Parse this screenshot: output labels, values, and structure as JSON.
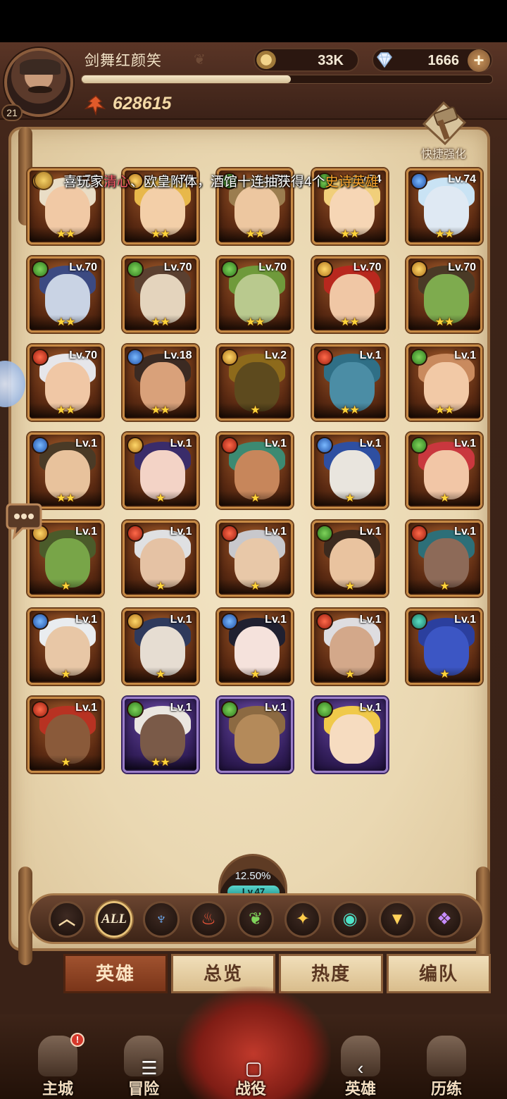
{
  "player": {
    "name": "剑舞红颜笑",
    "level": "21",
    "power": "628615",
    "xp_fraction": 0.51
  },
  "resources": {
    "gold": "33K",
    "gems": "1666"
  },
  "quick_upgrade": {
    "label": "快捷强化"
  },
  "ticker": {
    "prefix": "喜玩家",
    "player": "清心",
    "mid": "、欧皇附体，酒馆十连抽获得4个",
    "highlight": "史诗英雄"
  },
  "colors": {
    "faction_green": "#4aa83a",
    "faction_red": "#d8402a",
    "faction_blue": "#3a7cd8",
    "faction_gold": "#e0a838",
    "faction_teal": "#2fb59b",
    "faction_purple": "#8c4ee0",
    "tab_active": "#8b3e1f"
  },
  "heroes": [
    {
      "lv": "Lv.74",
      "stars": "★★",
      "faction": "gold",
      "hair": "#e9ddc6",
      "face": "#f1c9a5",
      "frame": "bronze"
    },
    {
      "lv": "Lv.74",
      "stars": "★★",
      "faction": "gold",
      "hair": "#e8b84a",
      "face": "#f3cfa8",
      "frame": "bronze"
    },
    {
      "lv": "Lv.74",
      "stars": "★★",
      "faction": "green",
      "hair": "#9b7d4f",
      "face": "#edc7a0",
      "frame": "bronze"
    },
    {
      "lv": "Lv.74",
      "stars": "★★",
      "faction": "green",
      "hair": "#f1cf7a",
      "face": "#f6d6b5",
      "frame": "bronze"
    },
    {
      "lv": "Lv.74",
      "stars": "★★",
      "faction": "blue",
      "hair": "#c9e3f4",
      "face": "#dfe9f3",
      "frame": "bronze"
    },
    {
      "lv": "Lv.70",
      "stars": "★★",
      "faction": "green",
      "hair": "#3c4a82",
      "face": "#c9d3e4",
      "frame": "bronze"
    },
    {
      "lv": "Lv.70",
      "stars": "★★",
      "faction": "green",
      "hair": "#5b4030",
      "face": "#e4d4bd",
      "frame": "bronze"
    },
    {
      "lv": "Lv.70",
      "stars": "★★",
      "faction": "green",
      "hair": "#6f9a3b",
      "face": "#b9c98e",
      "frame": "bronze"
    },
    {
      "lv": "Lv.70",
      "stars": "★★",
      "faction": "gold",
      "hair": "#b8281e",
      "face": "#f0c7a5",
      "frame": "bronze"
    },
    {
      "lv": "Lv.70",
      "stars": "★★",
      "faction": "gold",
      "hair": "#4a3a26",
      "face": "#7eab4e",
      "frame": "bronze"
    },
    {
      "lv": "Lv.70",
      "stars": "★★",
      "faction": "red",
      "hair": "#e6e6ea",
      "face": "#f0c7a5",
      "frame": "bronze"
    },
    {
      "lv": "Lv.18",
      "stars": "★★",
      "faction": "blue",
      "hair": "#3b2a22",
      "face": "#d9a17a",
      "frame": "bronze"
    },
    {
      "lv": "Lv.2",
      "stars": "★",
      "faction": "gold",
      "hair": "#8d6a1b",
      "face": "#5d4a1e",
      "frame": "bronze"
    },
    {
      "lv": "Lv.1",
      "stars": "★★",
      "faction": "red",
      "hair": "#2f6f86",
      "face": "#4b8da5",
      "frame": "bronze"
    },
    {
      "lv": "Lv.1",
      "stars": "★★",
      "faction": "green",
      "hair": "#c98a5e",
      "face": "#f2c9a6",
      "frame": "bronze"
    },
    {
      "lv": "Lv.1",
      "stars": "★★",
      "faction": "blue",
      "hair": "#4a3a26",
      "face": "#e8c29c",
      "frame": "bronze"
    },
    {
      "lv": "Lv.1",
      "stars": "★",
      "faction": "gold",
      "hair": "#3a2c6a",
      "face": "#f3d3c6",
      "frame": "bronze"
    },
    {
      "lv": "Lv.1",
      "stars": "★",
      "faction": "red",
      "hair": "#3c8a72",
      "face": "#c7865b",
      "frame": "bronze"
    },
    {
      "lv": "Lv.1",
      "stars": "★",
      "faction": "blue",
      "hair": "#2e4fa1",
      "face": "#e9e5de",
      "frame": "bronze"
    },
    {
      "lv": "Lv.1",
      "stars": "★",
      "faction": "green",
      "hair": "#c9373e",
      "face": "#f2c6a6",
      "frame": "bronze"
    },
    {
      "lv": "Lv.1",
      "stars": "★",
      "faction": "gold",
      "hair": "#4b5b2a",
      "face": "#78a548",
      "frame": "bronze"
    },
    {
      "lv": "Lv.1",
      "stars": "★",
      "faction": "red",
      "hair": "#dfe0e2",
      "face": "#e5c2a4",
      "frame": "bronze"
    },
    {
      "lv": "Lv.1",
      "stars": "★",
      "faction": "red",
      "hair": "#c8c8cc",
      "face": "#e8c8a8",
      "frame": "bronze"
    },
    {
      "lv": "Lv.1",
      "stars": "★",
      "faction": "green",
      "hair": "#3c2a1e",
      "face": "#e9c39f",
      "frame": "bronze"
    },
    {
      "lv": "Lv.1",
      "stars": "★",
      "faction": "red",
      "hair": "#2d6f78",
      "face": "#8d6a58",
      "frame": "bronze"
    },
    {
      "lv": "Lv.1",
      "stars": "★",
      "faction": "blue",
      "hair": "#e9ecef",
      "face": "#e8c7a6",
      "frame": "bronze"
    },
    {
      "lv": "Lv.1",
      "stars": "★",
      "faction": "gold",
      "hair": "#2f3a5c",
      "face": "#e6ddd2",
      "frame": "bronze"
    },
    {
      "lv": "Lv.1",
      "stars": "★",
      "faction": "blue",
      "hair": "#202030",
      "face": "#f5e2dc",
      "frame": "bronze"
    },
    {
      "lv": "Lv.1",
      "stars": "★",
      "faction": "red",
      "hair": "#dedde0",
      "face": "#d3a88a",
      "frame": "bronze"
    },
    {
      "lv": "Lv.1",
      "stars": "★",
      "faction": "teal",
      "hair": "#2b3f9e",
      "face": "#3c56c4",
      "frame": "bronze"
    },
    {
      "lv": "Lv.1",
      "stars": "★",
      "faction": "red",
      "hair": "#b83222",
      "face": "#8a5a3a",
      "frame": "bronze"
    },
    {
      "lv": "Lv.1",
      "stars": "★★",
      "faction": "green",
      "hair": "#eae6e0",
      "face": "#7a5a48",
      "frame": "purple"
    },
    {
      "lv": "Lv.1",
      "stars": "",
      "faction": "green",
      "hair": "#8c6a42",
      "face": "#b48a5a",
      "frame": "purple"
    },
    {
      "lv": "Lv.1",
      "stars": "",
      "faction": "green",
      "hair": "#f0c94a",
      "face": "#f6dcc0",
      "frame": "purple"
    }
  ],
  "collection": {
    "percent": "12.50%",
    "level": "Lv.47"
  },
  "filters": [
    {
      "icon": "chevron-up-icon",
      "symbol": "︿",
      "color": "#f3d9a6"
    },
    {
      "icon": "all-icon",
      "symbol": "ALL",
      "color": "#f5e8c8"
    },
    {
      "icon": "faction-blue-icon",
      "symbol": "♆",
      "color": "#6fb3ff"
    },
    {
      "icon": "faction-red-icon",
      "symbol": "♨",
      "color": "#ff5a3c"
    },
    {
      "icon": "faction-green-icon",
      "symbol": "❦",
      "color": "#7fd35b"
    },
    {
      "icon": "faction-gold-icon",
      "symbol": "✦",
      "color": "#ffcc4a"
    },
    {
      "icon": "faction-teal-icon",
      "symbol": "◉",
      "color": "#4fe3c8"
    },
    {
      "icon": "faction-yellow-icon",
      "symbol": "▼",
      "color": "#ffd25a"
    },
    {
      "icon": "faction-purple-icon",
      "symbol": "❖",
      "color": "#c68cff"
    }
  ],
  "tabs": [
    "英雄",
    "总览",
    "热度",
    "编队"
  ],
  "nav": [
    {
      "label": "主城",
      "icon": "castle-icon"
    },
    {
      "label": "冒险",
      "icon": "tower-icon"
    },
    {
      "label": "战役",
      "icon": "dragon-icon"
    },
    {
      "label": "英雄",
      "icon": "hero-icon"
    },
    {
      "label": "历练",
      "icon": "training-icon"
    }
  ],
  "notification": "!",
  "system_keys": [
    "☰",
    "▢",
    "‹"
  ]
}
